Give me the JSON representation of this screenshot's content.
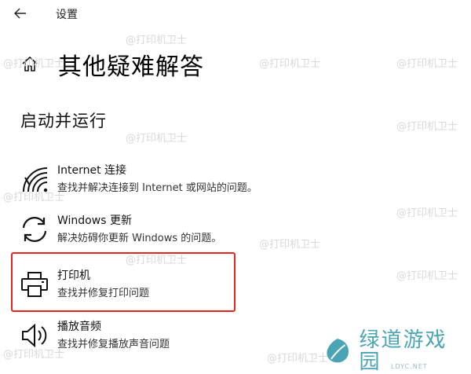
{
  "window": {
    "title": "设置"
  },
  "page": {
    "title": "其他疑难解答"
  },
  "section": {
    "title": "启动并运行"
  },
  "items": [
    {
      "title": "Internet 连接",
      "description": "查找并解决连接到 Internet 或网站的问题。",
      "icon": "wifi-icon"
    },
    {
      "title": "Windows 更新",
      "description": "解决妨碍你更新 Windows 的问题。",
      "icon": "sync-icon"
    },
    {
      "title": "打印机",
      "description": "查找并修复打印问题",
      "icon": "printer-icon"
    },
    {
      "title": "播放音频",
      "description": "查找并修复播放声音问题",
      "icon": "speaker-icon"
    }
  ],
  "colors": {
    "highlight": "#e52620",
    "logo": "#4aa4b4"
  },
  "watermark": {
    "text": "@打印机卫士"
  },
  "logo": {
    "text": "绿道游戏园",
    "sub": "LDYC.NET"
  }
}
